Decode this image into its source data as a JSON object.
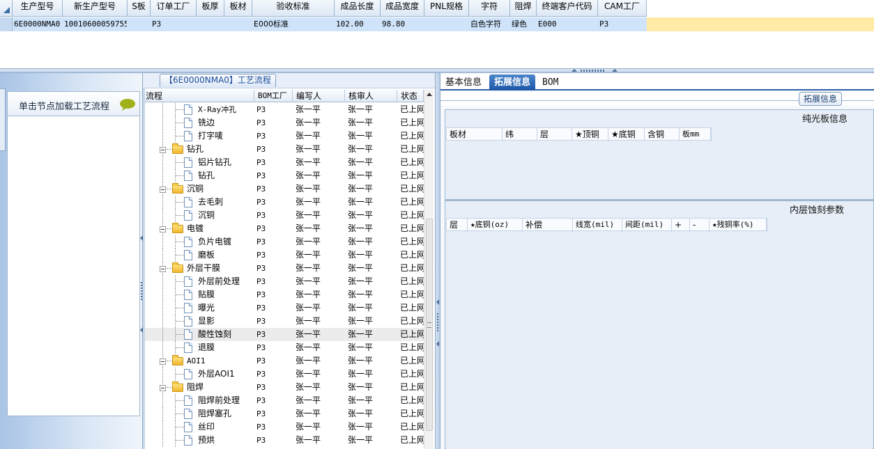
{
  "top_grid": {
    "headers": [
      "生产型号",
      "新生产型号",
      "S板",
      "订单工厂",
      "板厚",
      "板材",
      "验收标准",
      "成品长度",
      "成品宽度",
      "PNL规格",
      "字符",
      "阻焊",
      "终端客户代码",
      "CAM工厂"
    ],
    "rows": [
      [
        "6E0000NMA0",
        "10010600059755",
        "",
        "P3",
        "",
        "",
        "E000标准",
        "102.00",
        "98.80",
        "",
        "白色字符",
        "绿色",
        "E000",
        "P3"
      ]
    ]
  },
  "left_panel": {
    "load_hint": "单击节点加载工艺流程",
    "bubble_icon": "speech-bubble-icon",
    "bubble_color": "#9fb21a"
  },
  "process": {
    "title": "【6E0000NMA0】工艺流程",
    "columns": [
      "流程",
      "BOM工厂",
      "编写人",
      "核审人",
      "状态"
    ],
    "rows": [
      {
        "name": "X-Ray冲孔",
        "type": "step",
        "factory": "P3",
        "author": "张一平",
        "reviewer": "张一平",
        "status": "已上网"
      },
      {
        "name": "铣边",
        "type": "step",
        "factory": "P3",
        "author": "张一平",
        "reviewer": "张一平",
        "status": "已上网"
      },
      {
        "name": "打字唛",
        "type": "step",
        "factory": "P3",
        "author": "张一平",
        "reviewer": "张一平",
        "status": "已上网"
      },
      {
        "name": "钻孔",
        "type": "group",
        "factory": "P3",
        "author": "张一平",
        "reviewer": "张一平",
        "status": "已上网"
      },
      {
        "name": "铝片钻孔",
        "type": "step",
        "factory": "P3",
        "author": "张一平",
        "reviewer": "张一平",
        "status": "已上网"
      },
      {
        "name": "钻孔",
        "type": "step",
        "factory": "P3",
        "author": "张一平",
        "reviewer": "张一平",
        "status": "已上网"
      },
      {
        "name": "沉铜",
        "type": "group",
        "factory": "P3",
        "author": "张一平",
        "reviewer": "张一平",
        "status": "已上网"
      },
      {
        "name": "去毛刺",
        "type": "step",
        "factory": "P3",
        "author": "张一平",
        "reviewer": "张一平",
        "status": "已上网"
      },
      {
        "name": "沉铜",
        "type": "step",
        "factory": "P3",
        "author": "张一平",
        "reviewer": "张一平",
        "status": "已上网"
      },
      {
        "name": "电镀",
        "type": "group",
        "factory": "P3",
        "author": "张一平",
        "reviewer": "张一平",
        "status": "已上网"
      },
      {
        "name": "负片电镀",
        "type": "step",
        "factory": "P3",
        "author": "张一平",
        "reviewer": "张一平",
        "status": "已上网"
      },
      {
        "name": "磨板",
        "type": "step",
        "factory": "P3",
        "author": "张一平",
        "reviewer": "张一平",
        "status": "已上网"
      },
      {
        "name": "外层干膜",
        "type": "group",
        "factory": "P3",
        "author": "张一平",
        "reviewer": "张一平",
        "status": "已上网"
      },
      {
        "name": "外层前处理",
        "type": "step",
        "factory": "P3",
        "author": "张一平",
        "reviewer": "张一平",
        "status": "已上网"
      },
      {
        "name": "贴膜",
        "type": "step",
        "factory": "P3",
        "author": "张一平",
        "reviewer": "张一平",
        "status": "已上网"
      },
      {
        "name": "曝光",
        "type": "step",
        "factory": "P3",
        "author": "张一平",
        "reviewer": "张一平",
        "status": "已上网"
      },
      {
        "name": "显影",
        "type": "step",
        "factory": "P3",
        "author": "张一平",
        "reviewer": "张一平",
        "status": "已上网"
      },
      {
        "name": "酸性蚀刻",
        "type": "step",
        "factory": "P3",
        "author": "张一平",
        "reviewer": "张一平",
        "status": "已上网",
        "selected": true
      },
      {
        "name": "退膜",
        "type": "step",
        "factory": "P3",
        "author": "张一平",
        "reviewer": "张一平",
        "status": "已上网"
      },
      {
        "name": "AOI1",
        "type": "group",
        "factory": "P3",
        "author": "张一平",
        "reviewer": "张一平",
        "status": "已上网"
      },
      {
        "name": "外层AOI1",
        "type": "step",
        "factory": "P3",
        "author": "张一平",
        "reviewer": "张一平",
        "status": "已上网"
      },
      {
        "name": "阻焊",
        "type": "group",
        "factory": "P3",
        "author": "张一平",
        "reviewer": "张一平",
        "status": "已上网"
      },
      {
        "name": "阻焊前处理",
        "type": "step",
        "factory": "P3",
        "author": "张一平",
        "reviewer": "张一平",
        "status": "已上网"
      },
      {
        "name": "阻焊塞孔",
        "type": "step",
        "factory": "P3",
        "author": "张一平",
        "reviewer": "张一平",
        "status": "已上网"
      },
      {
        "name": "丝印",
        "type": "step",
        "factory": "P3",
        "author": "张一平",
        "reviewer": "张一平",
        "status": "已上网"
      },
      {
        "name": "预烘",
        "type": "step",
        "factory": "P3",
        "author": "张一平",
        "reviewer": "张一平",
        "status": "已上网"
      }
    ]
  },
  "right_panel": {
    "tabs": [
      "基本信息",
      "拓展信息",
      "BOM"
    ],
    "active_tab": "拓展信息",
    "group_label": "拓展信息",
    "bare_board": {
      "title": "纯光板信息",
      "columns": [
        "板材",
        "纬",
        "层",
        "★顶铜",
        "★底铜",
        "含铜",
        "板mm"
      ]
    },
    "inner_etch": {
      "title": "内层蚀刻参数",
      "columns": [
        "层",
        "★底铜(oz)",
        "补偿",
        "线宽(mil)",
        "间距(mil)",
        "+",
        "-",
        "★残铜率(%)"
      ]
    }
  },
  "colors": {
    "selected_row": "#cfe3fa",
    "grid_fill": "#ffeaa6",
    "active_tab": "#2f61a8",
    "accent_title": "#1a4b9c"
  }
}
